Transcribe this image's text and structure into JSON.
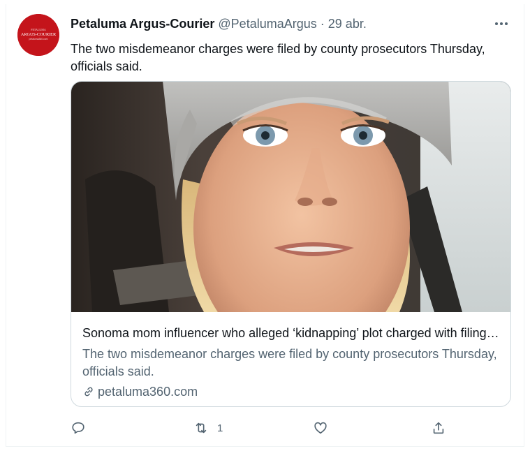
{
  "tweet": {
    "author": {
      "display_name": "Petaluma Argus-Courier",
      "handle": "@PetalumaArgus",
      "avatar_line1": "PETALUMA",
      "avatar_line2": "ARGUS-COURIER",
      "avatar_line3": "petaluma360.com"
    },
    "separator": "·",
    "date": "29 abr.",
    "text": "The two misdemeanor charges were filed by county prosecutors Thursday, officials said.",
    "card": {
      "title": "Sonoma mom influencer who alleged ‘kidnapping’ plot charged with filing false report",
      "description": "The two misdemeanor charges were filed by county prosecutors Thursday, officials said.",
      "domain": "petaluma360.com"
    },
    "actions": {
      "reply_count": "",
      "retweet_count": "1",
      "like_count": "",
      "share_count": ""
    }
  },
  "colors": {
    "text_primary": "#0f1419",
    "text_secondary": "#536471",
    "border": "#cfd9de",
    "avatar_bg": "#c4141b"
  },
  "icons": [
    "more-icon",
    "link-icon",
    "reply-icon",
    "retweet-icon",
    "like-icon",
    "share-icon"
  ]
}
